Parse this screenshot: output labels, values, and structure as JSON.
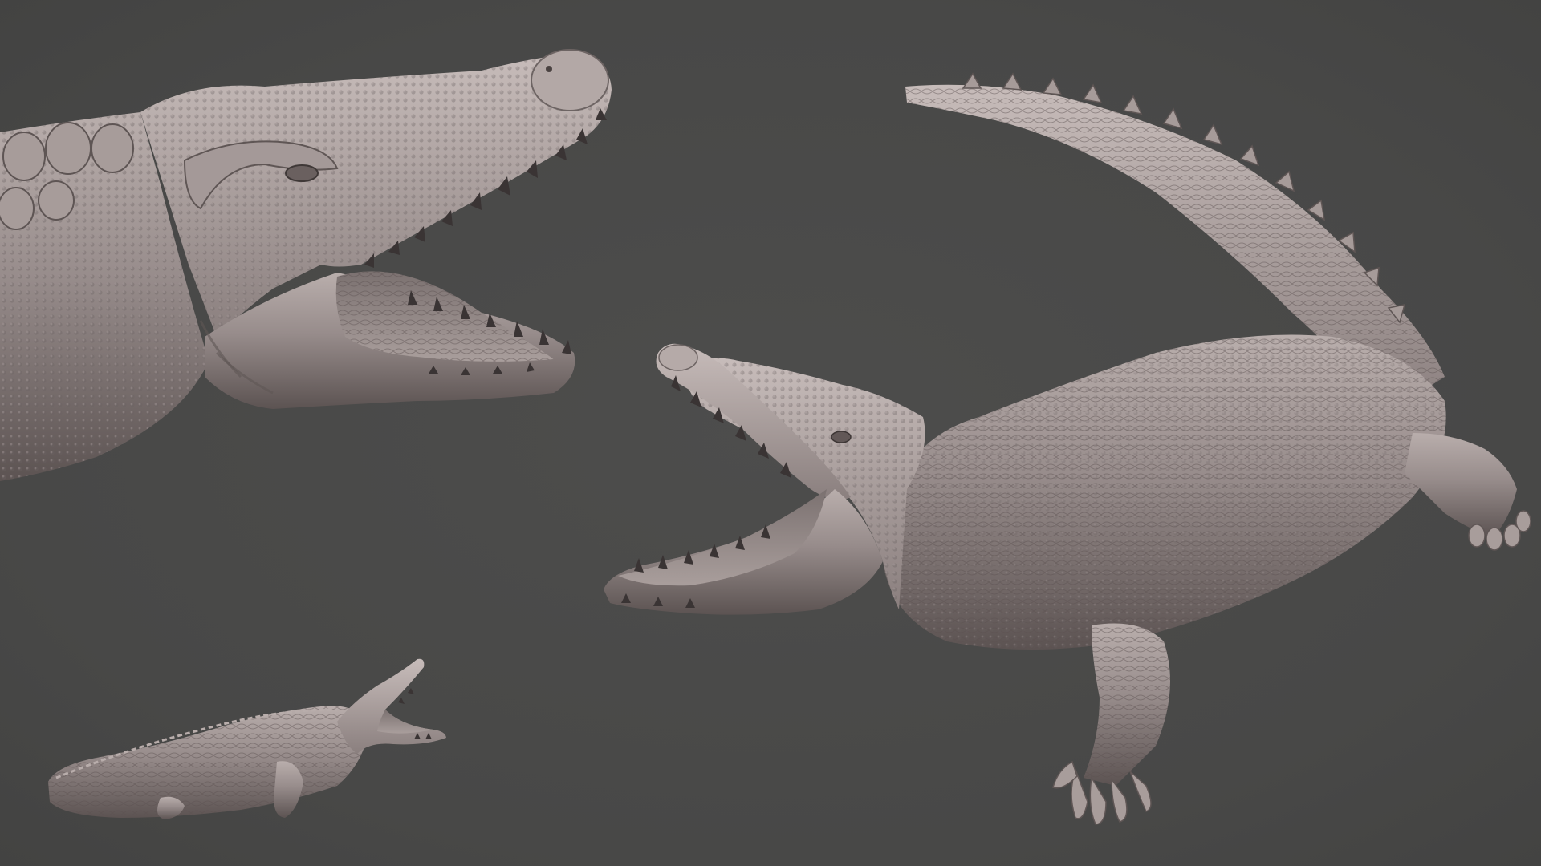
{
  "scene": {
    "background_color": "#4a4a49",
    "clay_color": "#9a8f8e",
    "clay_highlight": "#c2b6b4",
    "clay_shadow": "#5f5655",
    "teeth_color": "#3a3434"
  },
  "views": [
    {
      "name": "head-closeup-view",
      "content": "crocodile-head-sculpt"
    },
    {
      "name": "full-body-view",
      "content": "crocodile-full-sculpt"
    },
    {
      "name": "thumbnail-view",
      "content": "crocodile-small-sculpt"
    }
  ]
}
